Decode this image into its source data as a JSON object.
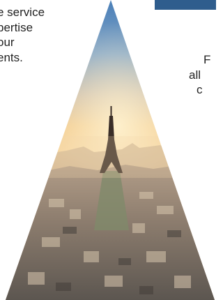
{
  "left_text": {
    "line1": "e service",
    "line2": "pertise",
    "line3": "our",
    "line4": "ents."
  },
  "right_text": {
    "line1": "F",
    "line2": "all",
    "line3": "c"
  },
  "photo": {
    "subject": "Eiffel Tower aerial view of Paris at sunset",
    "shape": "triangle"
  },
  "colors": {
    "accent_bar": "#2f5d8d",
    "text": "#222222"
  }
}
